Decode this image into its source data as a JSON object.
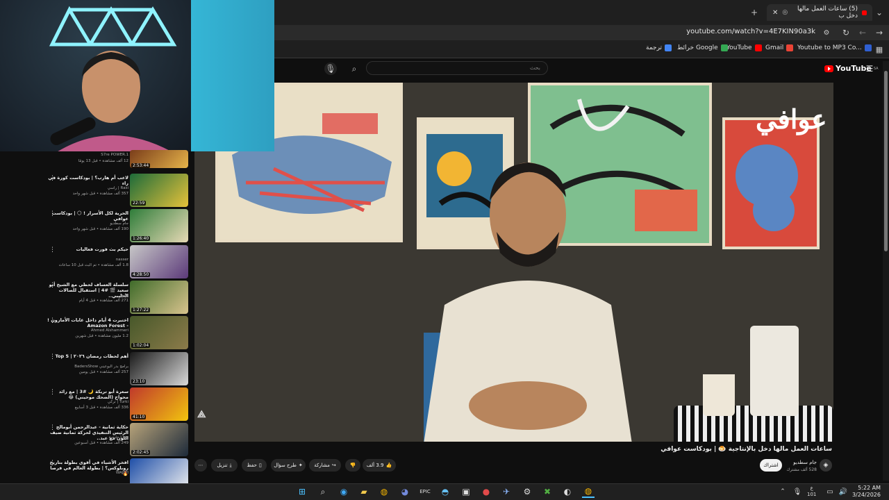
{
  "browser": {
    "tab": {
      "title": "(5) ساعات العمل مالها دخل ب"
    },
    "url": "youtube.com/watch?v=4E7KIN90a3k",
    "bookmarks": [
      {
        "label": "Youtube to MP3 Co...",
        "color": "#2f5fd1"
      },
      {
        "label": "Gmail",
        "color": "#ea4335"
      },
      {
        "label": "YouTube",
        "color": "#ff0000"
      },
      {
        "label": "خرائط Google",
        "color": "#34a853"
      },
      {
        "label": "ترجمة",
        "color": "#4285f4"
      }
    ]
  },
  "youtube": {
    "logo_text": "YouTube",
    "logo_sup": "SA",
    "search": {
      "placeholder": "بحث"
    }
  },
  "video": {
    "title": "ساعات العمل مالها دخل بالإنتاجية 🍮 | بودكاست عوافي",
    "podcast_logo": "عوافي",
    "channel": "جام سطديو",
    "subscribers": "528 ألف مشترك",
    "subscribe_label": "اشتراك",
    "likes": "3.9 ألف",
    "share_label": "مشاركة",
    "ask_label": "طرح سؤال",
    "save_label": "حفظ",
    "download_label": "تنزيل"
  },
  "sidebar_partial": {
    "channel": "S7re POWER.1",
    "meta": "12 ألف مشاهدة • قبل 13 يومًا",
    "duration": "2:53:44"
  },
  "recommended": [
    {
      "title": "لاعب أم هارب؟ | بودكاست كورة في راء",
      "channel": "Rasi | راسي",
      "meta": "357 ألف مشاهدة • قبل شهر واحد",
      "duration": "22:59",
      "color1": "#1d6b3a",
      "color2": "#e6c23a"
    },
    {
      "title": "الحرية لكل الأسرار ! 🌕 | بودكاست عوافي",
      "channel": "جام سطديو",
      "meta": "190 ألف مشاهدة • قبل شهر واحد",
      "duration": "1:26:40",
      "color1": "#2f7d3a",
      "color2": "#e7d9b5"
    },
    {
      "title": "حيكم بث فورت فعاليات",
      "channel": "nasser",
      "meta": "1.8 ألف مشاهدة • تم البث قبل 10 ساعات",
      "duration": "4:28:50",
      "color1": "#c7c7c7",
      "color2": "#5c3a7a"
    },
    {
      "title": "سلسلة العساف لحظي مع الشيخ أبو سعيد 🎬 #4 | استقبال للصالات الحليبي..",
      "channel": "حازم",
      "meta": "271 ألف مشاهدة • قبل 4 أيام",
      "duration": "1:27:22",
      "color1": "#3f6b2a",
      "color2": "#d8c38d"
    },
    {
      "title": "اختبرت 4 أيام داخل غابات الأمازون ! - Amazon Forest",
      "channel": "Ahmed Alshammeri",
      "meta": "1.2 مليون مشاهدة • قبل شهرين",
      "duration": "1:02:04",
      "color1": "#47582a",
      "color2": "#8c7b4a"
    },
    {
      "title": "أهم لحظات رمضان ٢٠٢٦ | Top 5",
      "channel": "برامج بدر البوعيني BadersShow",
      "meta": "257 ألف مشاهدة • قبل يومين",
      "duration": "23:10",
      "color1": "#1a1a1a",
      "color2": "#d9d9d9"
    },
    {
      "title": "سعرة أبو تريكة 🌙 #3 | مع رائد محواج (الضحك موحيني) 😂",
      "channel": "Turki | تركي",
      "meta": "336 ألف مشاهدة • قبل 3 أسابيع",
      "duration": "41:10",
      "color1": "#c0392b",
      "color2": "#f1c40f"
    },
    {
      "title": "حكاية ثمانية - عبدالرحمن أبومالح الرئيس التنفيذي لحركة ثمانية ضيف اللون مع عبد..",
      "channel": "روتانا خليجية",
      "meta": "249 ألف مشاهدة • قبل أسبوعين",
      "duration": "2:02:45",
      "color1": "#b7a37a",
      "color2": "#1d2a3a"
    },
    {
      "title": "افخر الأشياء في أقوى بطولة بتاريخ روبلوكس؟ | بطولة العالم في فرصا 🔥",
      "channel": "WAJEH",
      "meta": "",
      "duration": "",
      "color1": "#1f4fa8",
      "color2": "#f0f0f0"
    }
  ],
  "taskbar": {
    "time": "5:22 AM",
    "date": "3/24/2026",
    "lang": "ع",
    "sub": "101"
  }
}
